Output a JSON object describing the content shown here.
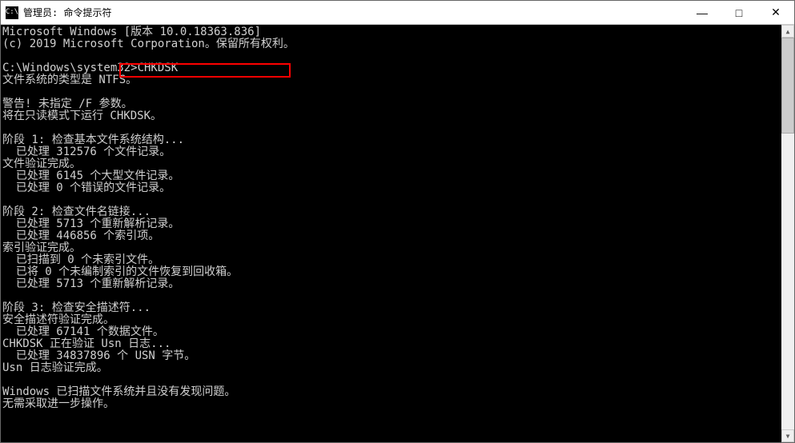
{
  "window": {
    "title_prefix": "管理员: ",
    "title": "命令提示符",
    "icon_text": "C:\\"
  },
  "controls": {
    "minimize": "—",
    "maximize": "□",
    "close": "✕"
  },
  "scrollbar": {
    "up": "▲",
    "down": "▼"
  },
  "terminal": {
    "lines": [
      "Microsoft Windows [版本 10.0.18363.836]",
      "(c) 2019 Microsoft Corporation。保留所有权利。",
      "",
      "C:\\Windows\\system32>CHKDSK",
      "文件系统的类型是 NTFS。",
      "",
      "警告! 未指定 /F 参数。",
      "将在只读模式下运行 CHKDSK。",
      "",
      "阶段 1: 检查基本文件系统结构...",
      "  已处理 312576 个文件记录。",
      "文件验证完成。",
      "  已处理 6145 个大型文件记录。",
      "  已处理 0 个错误的文件记录。",
      "",
      "阶段 2: 检查文件名链接...",
      "  已处理 5713 个重新解析记录。",
      "  已处理 446856 个索引项。",
      "索引验证完成。",
      "  已扫描到 0 个未索引文件。",
      "  已将 0 个未编制索引的文件恢复到回收箱。",
      "  已处理 5713 个重新解析记录。",
      "",
      "阶段 3: 检查安全描述符...",
      "安全描述符验证完成。",
      "  已处理 67141 个数据文件。",
      "CHKDSK 正在验证 Usn 日志...",
      "  已处理 34837896 个 USN 字节。",
      "Usn 日志验证完成。",
      "",
      "Windows 已扫描文件系统并且没有发现问题。",
      "无需采取进一步操作。",
      "",
      ""
    ]
  }
}
